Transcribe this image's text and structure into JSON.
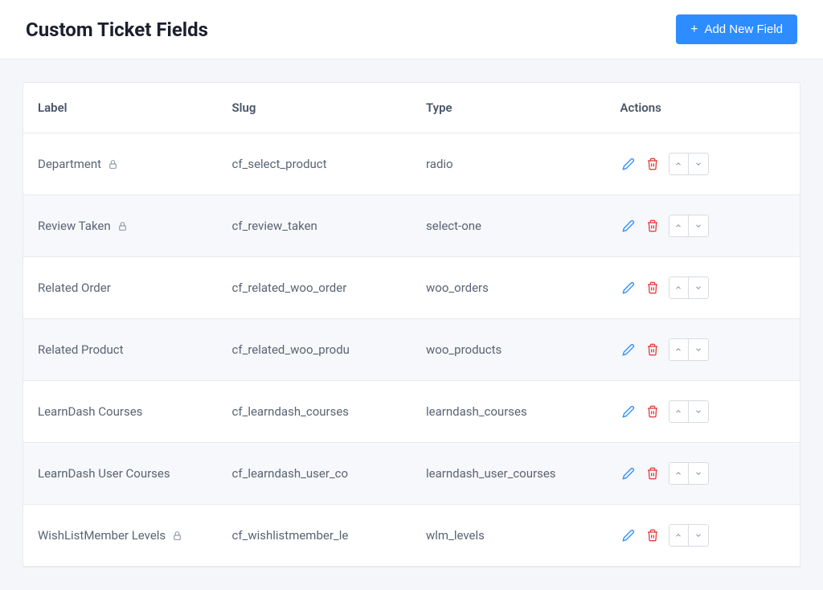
{
  "header": {
    "title": "Custom Ticket Fields",
    "add_button_label": "Add New Field"
  },
  "table": {
    "columns": {
      "label": "Label",
      "slug": "Slug",
      "type": "Type",
      "actions": "Actions"
    },
    "rows": [
      {
        "label": "Department",
        "locked": true,
        "slug": "cf_select_product",
        "type": "radio"
      },
      {
        "label": "Review Taken",
        "locked": true,
        "slug": "cf_review_taken",
        "type": "select-one"
      },
      {
        "label": "Related Order",
        "locked": false,
        "slug": "cf_related_woo_order",
        "type": "woo_orders"
      },
      {
        "label": "Related Product",
        "locked": false,
        "slug": "cf_related_woo_produ",
        "type": "woo_products"
      },
      {
        "label": "LearnDash Courses",
        "locked": false,
        "slug": "cf_learndash_courses",
        "type": "learndash_courses"
      },
      {
        "label": "LearnDash User Courses",
        "locked": false,
        "slug": "cf_learndash_user_co",
        "type": "learndash_user_courses"
      },
      {
        "label": "WishListMember Levels",
        "locked": true,
        "slug": "cf_wishlistmember_le",
        "type": "wlm_levels"
      }
    ]
  }
}
